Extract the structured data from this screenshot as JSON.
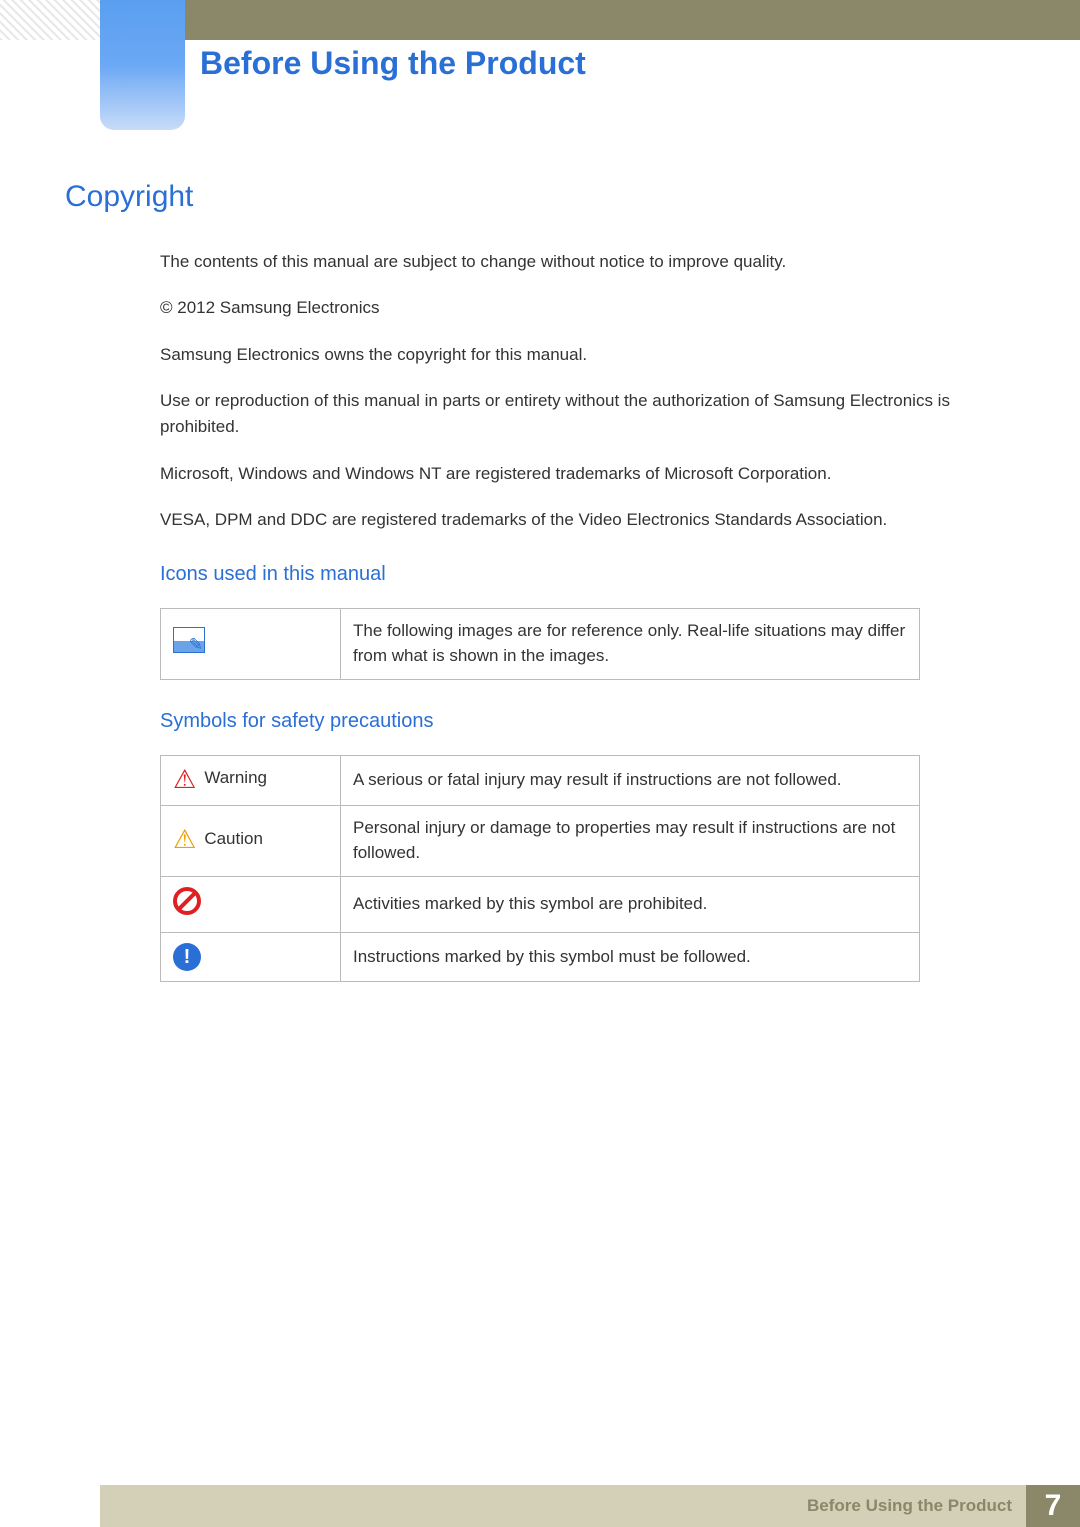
{
  "chapter_title": "Before Using the Product",
  "section_title": "Copyright",
  "paragraphs": [
    "The contents of this manual are subject to change without notice to improve quality.",
    "© 2012 Samsung Electronics",
    "Samsung Electronics owns the copyright for this manual.",
    "Use or reproduction of this manual in parts or entirety without the authorization of Samsung Electronics is prohibited.",
    "Microsoft, Windows and Windows NT are registered trademarks of Microsoft Corporation.",
    "VESA, DPM and DDC are registered trademarks of the Video Electronics Standards Association."
  ],
  "icons_section": {
    "title": "Icons used in this manual",
    "rows": [
      {
        "icon": "note",
        "label": "",
        "desc": "The following images are for reference only. Real-life situations may differ from what is shown in the images."
      }
    ]
  },
  "safety_section": {
    "title": "Symbols for safety precautions",
    "rows": [
      {
        "icon": "warn-red",
        "label": "Warning",
        "desc": "A serious or fatal injury may result if instructions are not followed."
      },
      {
        "icon": "warn-yellow",
        "label": "Caution",
        "desc": "Personal injury or damage to properties may result if instructions are not followed."
      },
      {
        "icon": "prohibit",
        "label": "",
        "desc": "Activities marked by this symbol are prohibited."
      },
      {
        "icon": "info",
        "label": "",
        "desc": "Instructions marked by this symbol must be followed."
      }
    ]
  },
  "footer": {
    "title": "Before Using the Product",
    "page": "7"
  }
}
